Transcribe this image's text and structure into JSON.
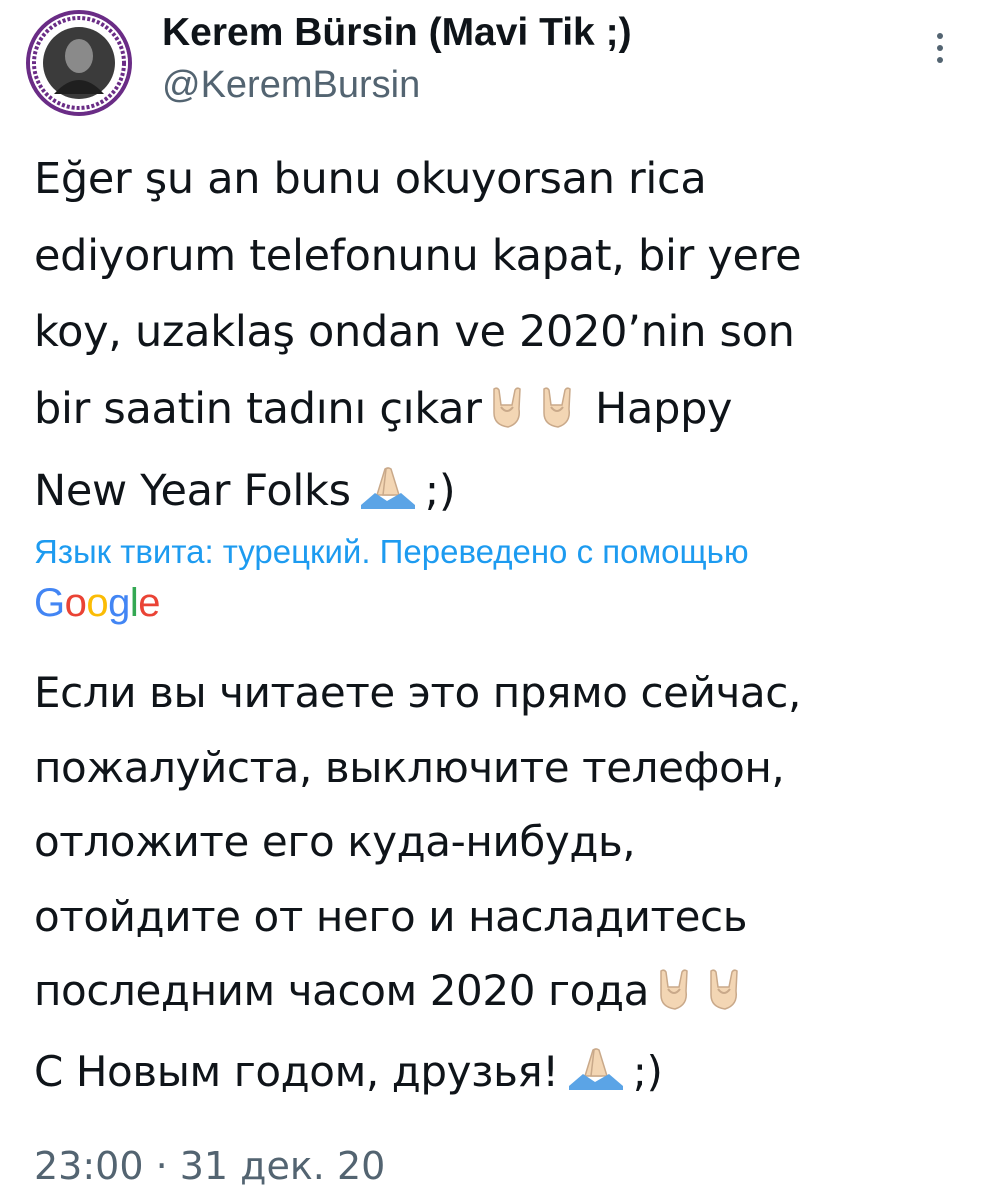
{
  "author": {
    "name": "Kerem Bürsin (Mavi Tik ;)",
    "handle": "@KeremBursin",
    "avatar_ring_color": "#6a2c86"
  },
  "tweet": {
    "text_part1": "Eğer şu an bunu okuyorsan rica\nediyorum telefonunu kapat, bir yere\nkoy, uzaklaş ondan ve 2020’nin son\nbir saatin tadını çıkar",
    "text_part2": "Happy\nNew Year Folks",
    "text_part3": ";)"
  },
  "translation": {
    "note": "Язык твита: турецкий. Переведено с помощью",
    "provider_letters": [
      "G",
      "o",
      "o",
      "g",
      "l",
      "e"
    ],
    "text_part1": "Если вы читаете это прямо сейчас,\nпожалуйста, выключите телефон,\nотложите его куда-нибудь,\nотойдите от него и насладитесь\nпоследним часом 2020 года",
    "text_part2": "С Новым годом, друзья!",
    "text_part3": ";)"
  },
  "timestamp": "23:00 · 31 дек. 20",
  "icons": {
    "more": "more-vertical-icon",
    "rock_on": "sign-of-the-horns-emoji",
    "pray": "folded-hands-emoji"
  },
  "colors": {
    "link": "#1d9bf0",
    "secondary_text": "#536471",
    "emoji_skin": "#f3d6b4"
  }
}
